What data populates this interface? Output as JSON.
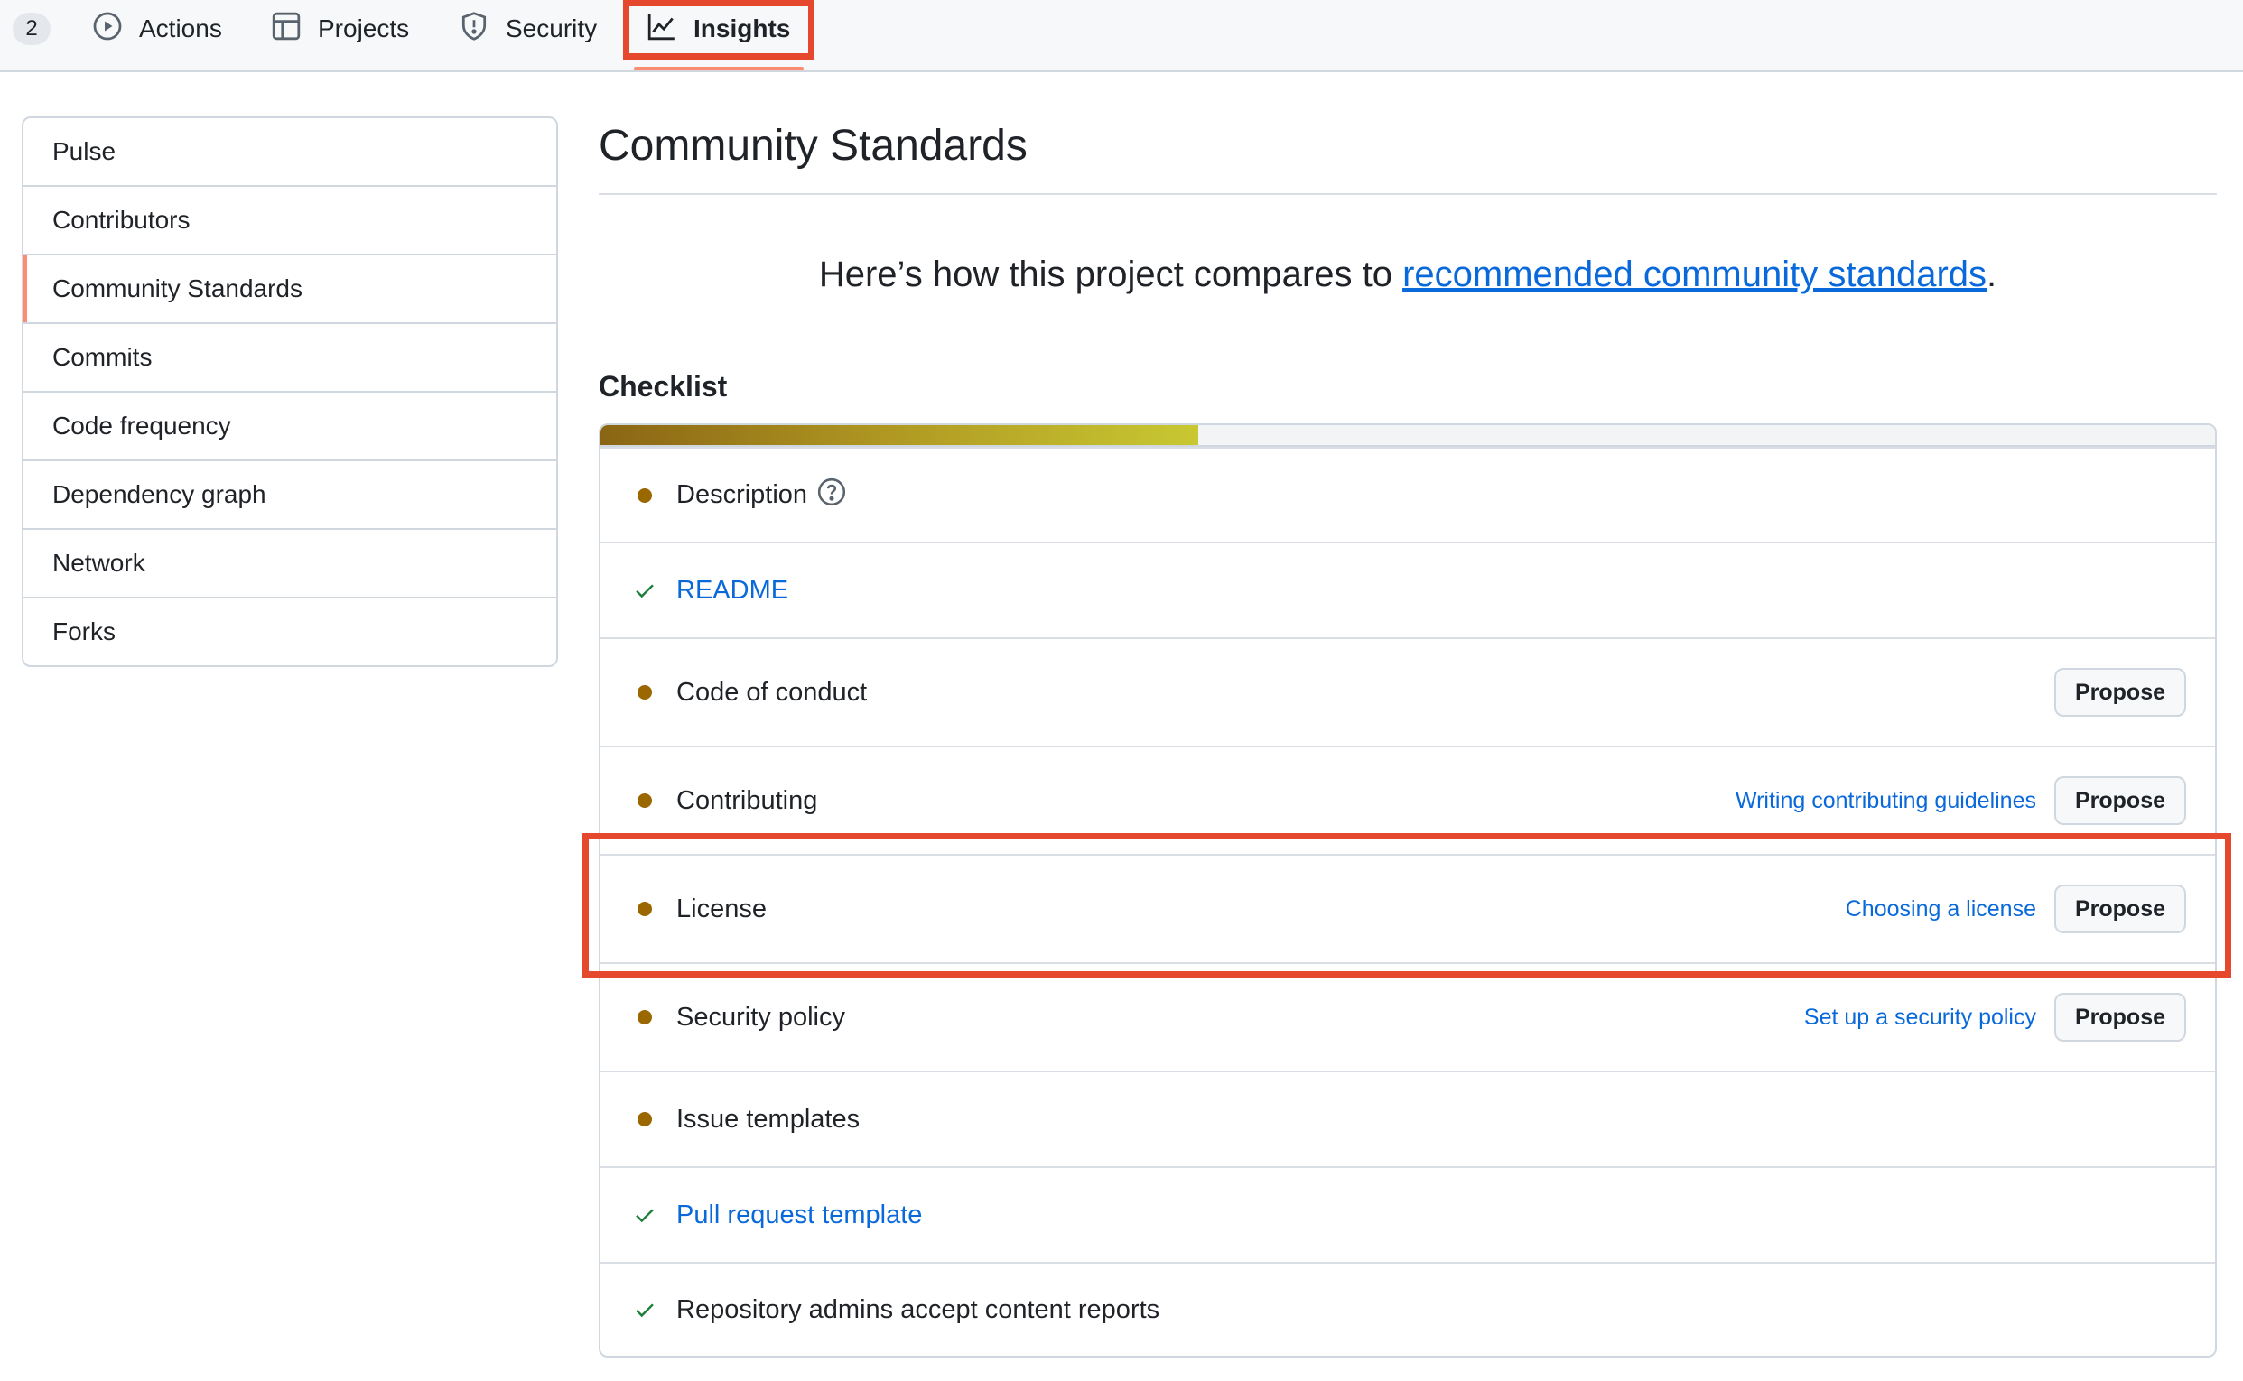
{
  "topnav": {
    "counter": "2",
    "tabs": [
      {
        "label": "Actions",
        "icon": "play-circle-icon"
      },
      {
        "label": "Projects",
        "icon": "table-icon"
      },
      {
        "label": "Security",
        "icon": "shield-icon"
      },
      {
        "label": "Insights",
        "icon": "graph-icon",
        "active": true
      }
    ]
  },
  "sidebar": {
    "items": [
      {
        "label": "Pulse"
      },
      {
        "label": "Contributors"
      },
      {
        "label": "Community Standards",
        "selected": true
      },
      {
        "label": "Commits"
      },
      {
        "label": "Code frequency"
      },
      {
        "label": "Dependency graph"
      },
      {
        "label": "Network"
      },
      {
        "label": "Forks"
      }
    ]
  },
  "main": {
    "title": "Community Standards",
    "intro_prefix": "Here’s how this project compares to ",
    "intro_link": "recommended community standards",
    "intro_suffix": ".",
    "checklist_heading": "Checklist",
    "progress_fraction": 0.37,
    "items": [
      {
        "label": "Description",
        "status": "missing",
        "help": true
      },
      {
        "label": "README",
        "status": "done",
        "link": true
      },
      {
        "label": "Code of conduct",
        "status": "missing",
        "button": "Propose"
      },
      {
        "label": "Contributing",
        "status": "missing",
        "guide": "Writing contributing guidelines",
        "button": "Propose"
      },
      {
        "label": "License",
        "status": "missing",
        "guide": "Choosing a license",
        "button": "Propose",
        "highlighted": true
      },
      {
        "label": "Security policy",
        "status": "missing",
        "guide": "Set up a security policy",
        "button": "Propose"
      },
      {
        "label": "Issue templates",
        "status": "missing"
      },
      {
        "label": "Pull request template",
        "status": "done",
        "link": true
      },
      {
        "label": "Repository admins accept content reports",
        "status": "done"
      }
    ]
  },
  "colors": {
    "accent_underline": "#fd8c73",
    "highlight_box": "#e5482d",
    "link": "#0969da",
    "missing_dot": "#9a6700",
    "done_check": "#1a7f37"
  }
}
